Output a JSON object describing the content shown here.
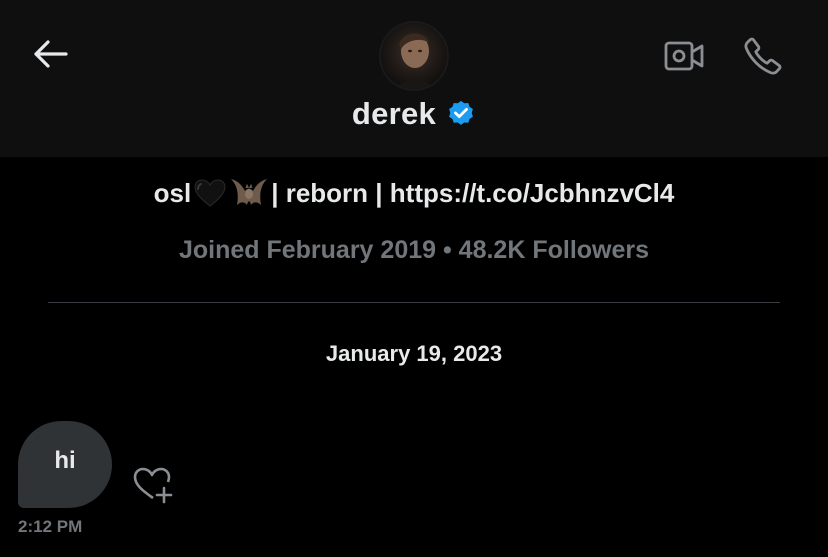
{
  "header": {
    "back_icon": "arrow-left-icon",
    "username": "derek",
    "verified_icon": "verified-badge-icon",
    "video_icon": "video-call-icon",
    "phone_icon": "phone-icon",
    "verified_color": "#1d9bf0"
  },
  "profile": {
    "bio_prefix": "osl",
    "bio_suffix": "| reborn | https://t.co/JcbhnzvCl4",
    "bio_emojis": [
      "black-heart-emoji",
      "bat-emoji"
    ],
    "meta": "Joined February 2019 • 48.2K Followers"
  },
  "conversation": {
    "date": "January 19, 2023",
    "messages": [
      {
        "text": "hi",
        "time": "2:12 PM",
        "react_icon": "heart-add-icon"
      }
    ]
  },
  "colors": {
    "background": "#000000",
    "header_background": "#0f0f0f",
    "bubble": "#2f3336",
    "muted_text": "#71767b",
    "text": "#e7e9ea"
  }
}
